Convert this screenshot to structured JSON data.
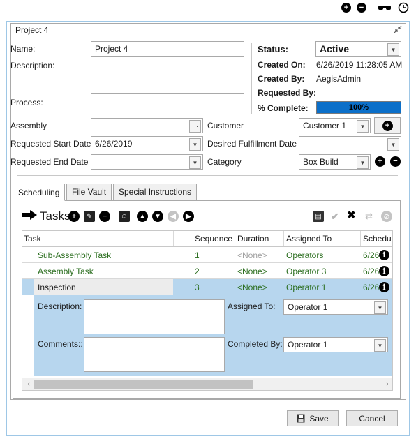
{
  "toolbar": {
    "add_icon": "plus-circle-icon",
    "remove_icon": "minus-circle-icon",
    "glasses_icon": "glasses-icon",
    "clock_icon": "clock-icon"
  },
  "window": {
    "title": "Project 4"
  },
  "form": {
    "name_label": "Name:",
    "name_value": "Project 4",
    "description_label": "Description:",
    "process_label": "Process:",
    "assembly_label": "Assembly",
    "assembly_browse": "···",
    "req_start_label": "Requested Start Date",
    "req_start_value": "6/26/2019",
    "req_end_label": "Requested End Date",
    "req_end_value": "",
    "customer_label": "Customer",
    "customer_value": "Customer 1",
    "desired_label": "Desired Fulfillment Date",
    "category_label": "Category",
    "category_value": "Box Build"
  },
  "status": {
    "status_label": "Status:",
    "status_value": "Active",
    "created_on_label": "Created On:",
    "created_on_value": "6/26/2019 11:28:05 AM",
    "created_by_label": "Created By:",
    "created_by_value": "AegisAdmin",
    "requested_by_label": "Requested By:",
    "complete_label": "% Complete:",
    "complete_value": "100%",
    "complete_fraction": 1.0,
    "accent": "#0b6fc9"
  },
  "tabs": [
    {
      "label": "Scheduling"
    },
    {
      "label": "File Vault"
    },
    {
      "label": "Special Instructions"
    }
  ],
  "tasks": {
    "title": "Tasks",
    "columns": [
      "Task",
      "Sequence",
      "Duration",
      "Assigned To",
      "Schedul"
    ],
    "rows": [
      {
        "task": "Sub-Assembly Task",
        "sequence": "1",
        "duration": "<None>",
        "assigned": "Operators",
        "schedule": "6/26"
      },
      {
        "task": "Assembly Task",
        "sequence": "2",
        "duration": "<None>",
        "assigned": "Operator 3",
        "schedule": "6/26"
      },
      {
        "task": "Inspection",
        "sequence": "3",
        "duration": "<None>",
        "assigned": "Operator 1",
        "schedule": "6/26"
      }
    ],
    "detail": {
      "description_label": "Description:",
      "comments_label": "Comments::",
      "assigned_label": "Assigned To:",
      "assigned_value": "Operator 1",
      "completed_label": "Completed By:",
      "completed_value": "Operator 1"
    },
    "selected_color": "#b7d6ee"
  },
  "footer": {
    "save_label": "Save",
    "cancel_label": "Cancel"
  }
}
